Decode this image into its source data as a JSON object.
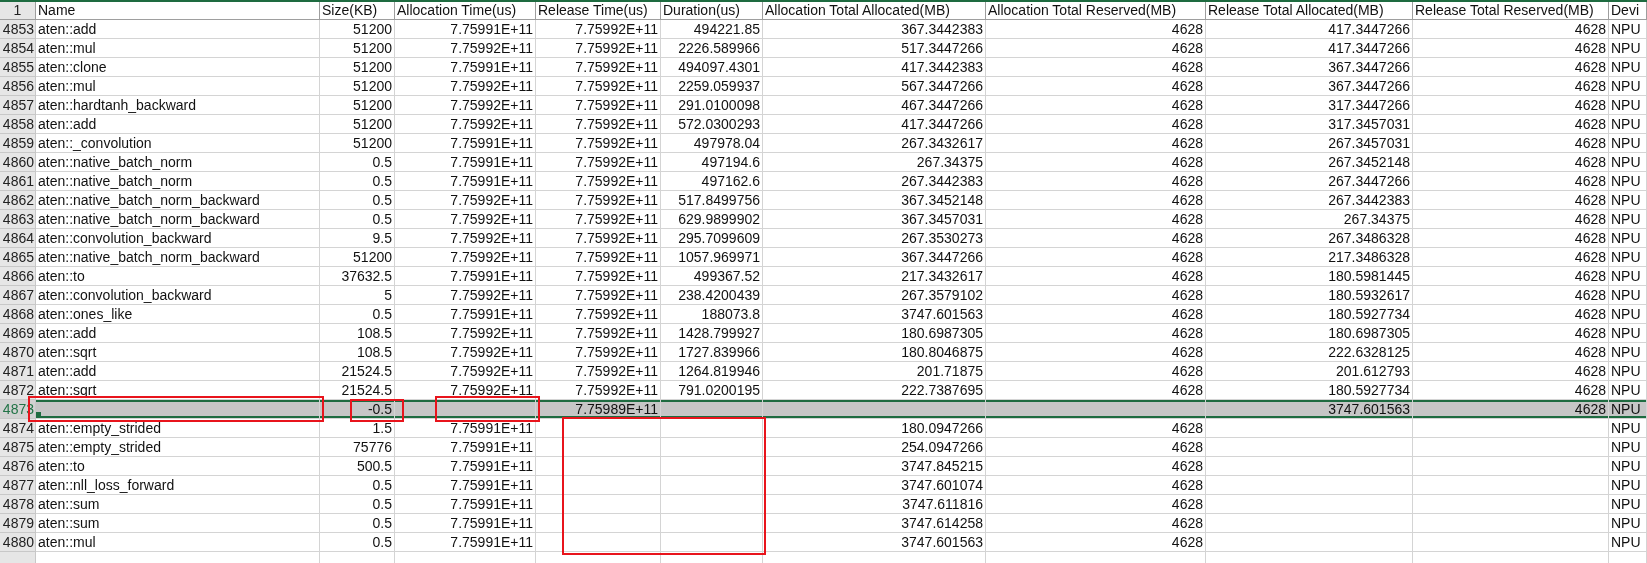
{
  "header_row_number": "1",
  "columns": [
    {
      "label": "Name",
      "kind": "text"
    },
    {
      "label": "Size(KB)",
      "kind": "number"
    },
    {
      "label": "Allocation Time(us)",
      "kind": "number"
    },
    {
      "label": "Release Time(us)",
      "kind": "number"
    },
    {
      "label": "Duration(us)",
      "kind": "number"
    },
    {
      "label": "Allocation Total Allocated(MB)",
      "kind": "number"
    },
    {
      "label": "Allocation Total Reserved(MB)",
      "kind": "number"
    },
    {
      "label": "Release Total Allocated(MB)",
      "kind": "number"
    },
    {
      "label": "Release Total Reserved(MB)",
      "kind": "number"
    },
    {
      "label": "Devi",
      "kind": "text"
    }
  ],
  "rows": [
    {
      "number": "4853",
      "selected": false,
      "cells": [
        "aten::add",
        "51200",
        "7.75991E+11",
        "7.75992E+11",
        "494221.85",
        "367.3442383",
        "4628",
        "417.3447266",
        "4628",
        "NPU"
      ]
    },
    {
      "number": "4854",
      "selected": false,
      "cells": [
        "aten::mul",
        "51200",
        "7.75992E+11",
        "7.75992E+11",
        "2226.589966",
        "517.3447266",
        "4628",
        "417.3447266",
        "4628",
        "NPU"
      ]
    },
    {
      "number": "4855",
      "selected": false,
      "cells": [
        "aten::clone",
        "51200",
        "7.75991E+11",
        "7.75992E+11",
        "494097.4301",
        "417.3442383",
        "4628",
        "367.3447266",
        "4628",
        "NPU"
      ]
    },
    {
      "number": "4856",
      "selected": false,
      "cells": [
        "aten::mul",
        "51200",
        "7.75992E+11",
        "7.75992E+11",
        "2259.059937",
        "567.3447266",
        "4628",
        "367.3447266",
        "4628",
        "NPU"
      ]
    },
    {
      "number": "4857",
      "selected": false,
      "cells": [
        "aten::hardtanh_backward",
        "51200",
        "7.75992E+11",
        "7.75992E+11",
        "291.0100098",
        "467.3447266",
        "4628",
        "317.3447266",
        "4628",
        "NPU"
      ]
    },
    {
      "number": "4858",
      "selected": false,
      "cells": [
        "aten::add",
        "51200",
        "7.75992E+11",
        "7.75992E+11",
        "572.0300293",
        "417.3447266",
        "4628",
        "317.3457031",
        "4628",
        "NPU"
      ]
    },
    {
      "number": "4859",
      "selected": false,
      "cells": [
        "aten::_convolution",
        "51200",
        "7.75991E+11",
        "7.75992E+11",
        "497978.04",
        "267.3432617",
        "4628",
        "267.3457031",
        "4628",
        "NPU"
      ]
    },
    {
      "number": "4860",
      "selected": false,
      "cells": [
        "aten::native_batch_norm",
        "0.5",
        "7.75991E+11",
        "7.75992E+11",
        "497194.6",
        "267.34375",
        "4628",
        "267.3452148",
        "4628",
        "NPU"
      ]
    },
    {
      "number": "4861",
      "selected": false,
      "cells": [
        "aten::native_batch_norm",
        "0.5",
        "7.75991E+11",
        "7.75992E+11",
        "497162.6",
        "267.3442383",
        "4628",
        "267.3447266",
        "4628",
        "NPU"
      ]
    },
    {
      "number": "4862",
      "selected": false,
      "cells": [
        "aten::native_batch_norm_backward",
        "0.5",
        "7.75992E+11",
        "7.75992E+11",
        "517.8499756",
        "367.3452148",
        "4628",
        "267.3442383",
        "4628",
        "NPU"
      ]
    },
    {
      "number": "4863",
      "selected": false,
      "cells": [
        "aten::native_batch_norm_backward",
        "0.5",
        "7.75992E+11",
        "7.75992E+11",
        "629.9899902",
        "367.3457031",
        "4628",
        "267.34375",
        "4628",
        "NPU"
      ]
    },
    {
      "number": "4864",
      "selected": false,
      "cells": [
        "aten::convolution_backward",
        "9.5",
        "7.75992E+11",
        "7.75992E+11",
        "295.7099609",
        "267.3530273",
        "4628",
        "267.3486328",
        "4628",
        "NPU"
      ]
    },
    {
      "number": "4865",
      "selected": false,
      "cells": [
        "aten::native_batch_norm_backward",
        "51200",
        "7.75992E+11",
        "7.75992E+11",
        "1057.969971",
        "367.3447266",
        "4628",
        "217.3486328",
        "4628",
        "NPU"
      ]
    },
    {
      "number": "4866",
      "selected": false,
      "cells": [
        "aten::to",
        "37632.5",
        "7.75991E+11",
        "7.75992E+11",
        "499367.52",
        "217.3432617",
        "4628",
        "180.5981445",
        "4628",
        "NPU"
      ]
    },
    {
      "number": "4867",
      "selected": false,
      "cells": [
        "aten::convolution_backward",
        "5",
        "7.75992E+11",
        "7.75992E+11",
        "238.4200439",
        "267.3579102",
        "4628",
        "180.5932617",
        "4628",
        "NPU"
      ]
    },
    {
      "number": "4868",
      "selected": false,
      "cells": [
        "aten::ones_like",
        "0.5",
        "7.75991E+11",
        "7.75992E+11",
        "188073.8",
        "3747.601563",
        "4628",
        "180.5927734",
        "4628",
        "NPU"
      ]
    },
    {
      "number": "4869",
      "selected": false,
      "cells": [
        "aten::add",
        "108.5",
        "7.75992E+11",
        "7.75992E+11",
        "1428.799927",
        "180.6987305",
        "4628",
        "180.6987305",
        "4628",
        "NPU"
      ]
    },
    {
      "number": "4870",
      "selected": false,
      "cells": [
        "aten::sqrt",
        "108.5",
        "7.75992E+11",
        "7.75992E+11",
        "1727.839966",
        "180.8046875",
        "4628",
        "222.6328125",
        "4628",
        "NPU"
      ]
    },
    {
      "number": "4871",
      "selected": false,
      "cells": [
        "aten::add",
        "21524.5",
        "7.75992E+11",
        "7.75992E+11",
        "1264.819946",
        "201.71875",
        "4628",
        "201.612793",
        "4628",
        "NPU"
      ]
    },
    {
      "number": "4872",
      "selected": false,
      "cells": [
        "aten::sqrt",
        "21524.5",
        "7.75992E+11",
        "7.75992E+11",
        "791.0200195",
        "222.7387695",
        "4628",
        "180.5927734",
        "4628",
        "NPU"
      ]
    },
    {
      "number": "4873",
      "selected": true,
      "cells": [
        null,
        "-0.5",
        null,
        "7.75989E+11",
        null,
        null,
        null,
        "3747.601563",
        "4628",
        "NPU"
      ]
    },
    {
      "number": "4874",
      "selected": false,
      "cells": [
        "aten::empty_strided",
        "1.5",
        "7.75991E+11",
        null,
        null,
        "180.0947266",
        "4628",
        null,
        null,
        "NPU"
      ]
    },
    {
      "number": "4875",
      "selected": false,
      "cells": [
        "aten::empty_strided",
        "75776",
        "7.75991E+11",
        null,
        null,
        "254.0947266",
        "4628",
        null,
        null,
        "NPU"
      ]
    },
    {
      "number": "4876",
      "selected": false,
      "cells": [
        "aten::to",
        "500.5",
        "7.75991E+11",
        null,
        null,
        "3747.845215",
        "4628",
        null,
        null,
        "NPU"
      ]
    },
    {
      "number": "4877",
      "selected": false,
      "cells": [
        "aten::nll_loss_forward",
        "0.5",
        "7.75991E+11",
        null,
        null,
        "3747.601074",
        "4628",
        null,
        null,
        "NPU"
      ]
    },
    {
      "number": "4878",
      "selected": false,
      "cells": [
        "aten::sum",
        "0.5",
        "7.75991E+11",
        null,
        null,
        "3747.611816",
        "4628",
        null,
        null,
        "NPU"
      ]
    },
    {
      "number": "4879",
      "selected": false,
      "cells": [
        "aten::sum",
        "0.5",
        "7.75991E+11",
        null,
        null,
        "3747.614258",
        "4628",
        null,
        null,
        "NPU"
      ]
    },
    {
      "number": "4880",
      "selected": false,
      "cells": [
        "aten::mul",
        "0.5",
        "7.75991E+11",
        null,
        null,
        "3747.601563",
        "4628",
        null,
        null,
        "NPU"
      ]
    },
    {
      "number": null,
      "selected": false,
      "cells": [
        null,
        null,
        null,
        null,
        null,
        null,
        null,
        null,
        null,
        null
      ]
    }
  ]
}
